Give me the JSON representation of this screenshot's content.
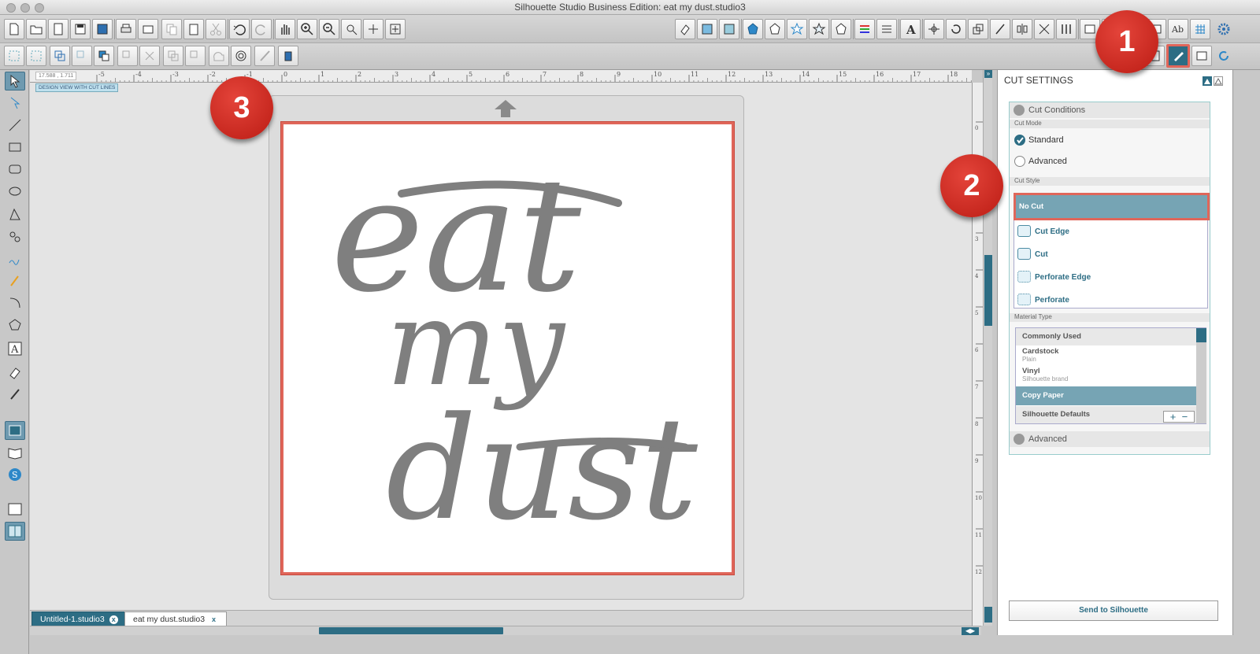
{
  "window": {
    "title": "Silhouette Studio Business Edition: eat my dust.studio3"
  },
  "ruler": {
    "coords": "17.588 , 1.711",
    "top_ticks": [
      "-5",
      "-4",
      "-3",
      "-2",
      "-1",
      "0",
      "1",
      "2",
      "3",
      "4",
      "5",
      "6",
      "7",
      "8",
      "9",
      "10",
      "11",
      "12",
      "13",
      "14",
      "15",
      "16",
      "17",
      "18"
    ],
    "left_ticks": [
      "0",
      "1",
      "2",
      "3",
      "4",
      "5",
      "6",
      "7",
      "8",
      "9",
      "10",
      "11",
      "12"
    ]
  },
  "view_label": "DESIGN VIEW WITH CUT LINES",
  "design": {
    "line1": "eat",
    "line2": "my",
    "line3": "dust",
    "color": "#7f7f7f"
  },
  "badges": {
    "one": "1",
    "two": "2",
    "three": "3"
  },
  "tabs": [
    {
      "label": "Untitled-1.studio3",
      "close": "x"
    },
    {
      "label": "eat my dust.studio3",
      "close": "x"
    }
  ],
  "panel": {
    "title": "CUT SETTINGS",
    "cut_conditions": "Cut Conditions",
    "cut_mode_label": "Cut Mode",
    "modes": [
      {
        "label": "Standard",
        "selected": true
      },
      {
        "label": "Advanced",
        "selected": false
      }
    ],
    "cut_style_label": "Cut Style",
    "styles": [
      "No Cut",
      "Cut Edge",
      "Cut",
      "Perforate Edge",
      "Perforate"
    ],
    "selected_style": "No Cut",
    "material_type_label": "Material Type",
    "materials": [
      {
        "name": "Commonly Used",
        "sub": ""
      },
      {
        "name": "Cardstock",
        "sub": "Plain"
      },
      {
        "name": "Vinyl",
        "sub": "Silhouette brand"
      },
      {
        "name": "Copy Paper",
        "sub": ""
      },
      {
        "name": "Silhouette Defaults",
        "sub": ""
      }
    ],
    "selected_material": "Copy Paper",
    "add": "+",
    "remove": "−",
    "advanced": "Advanced",
    "send": "Send to Silhouette"
  },
  "colors": {
    "accent": "#2d6d84",
    "highlight": "#e0665a",
    "badge": "#d42c22"
  }
}
